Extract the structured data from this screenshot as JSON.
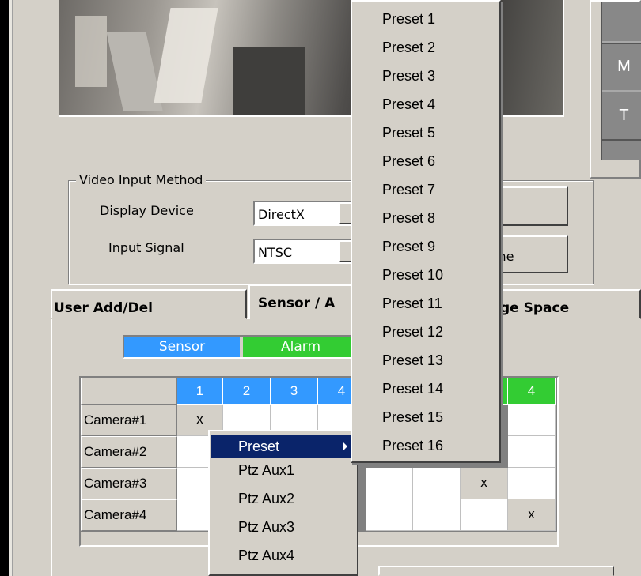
{
  "right_panel": {
    "buttons": [
      "",
      "M",
      "T"
    ]
  },
  "video_input": {
    "legend": "Video Input Method",
    "display_device_label": "Display Device",
    "display_device_value": "DirectX",
    "input_signal_label": "Input Signal",
    "input_signal_value": "NTSC",
    "button2_partial": "me"
  },
  "tabs": [
    {
      "label": "User Add/Del"
    },
    {
      "label": "Sensor / A"
    },
    {
      "label": "ge Space"
    }
  ],
  "legend": {
    "sensor": "Sensor",
    "alarm": "Alarm"
  },
  "colors": {
    "sensor": "#3399ff",
    "alarm": "#33cc33",
    "menu_highlight": "#0a246a",
    "panel": "#d4d0c8"
  },
  "grid": {
    "sensor_cols": [
      "1",
      "2",
      "3",
      "4"
    ],
    "alarm_cols": [
      "4"
    ],
    "rows": [
      {
        "label": "Camera#1",
        "marks": [
          "x"
        ]
      },
      {
        "label": "Camera#2",
        "marks": []
      },
      {
        "label": "Camera#3",
        "marks": [
          "x"
        ]
      },
      {
        "label": "Camera#4",
        "marks": [
          "x"
        ]
      }
    ]
  },
  "context_menu": {
    "items": [
      "Preset",
      "Ptz Aux1",
      "Ptz Aux2",
      "Ptz Aux3",
      "Ptz Aux4"
    ],
    "selected": "Preset"
  },
  "preset_submenu": {
    "items": [
      "Preset 1",
      "Preset 2",
      "Preset 3",
      "Preset 4",
      "Preset 5",
      "Preset 6",
      "Preset 7",
      "Preset 8",
      "Preset 9",
      "Preset 10",
      "Preset 11",
      "Preset 12",
      "Preset 13",
      "Preset 14",
      "Preset 15",
      "Preset 16"
    ]
  }
}
